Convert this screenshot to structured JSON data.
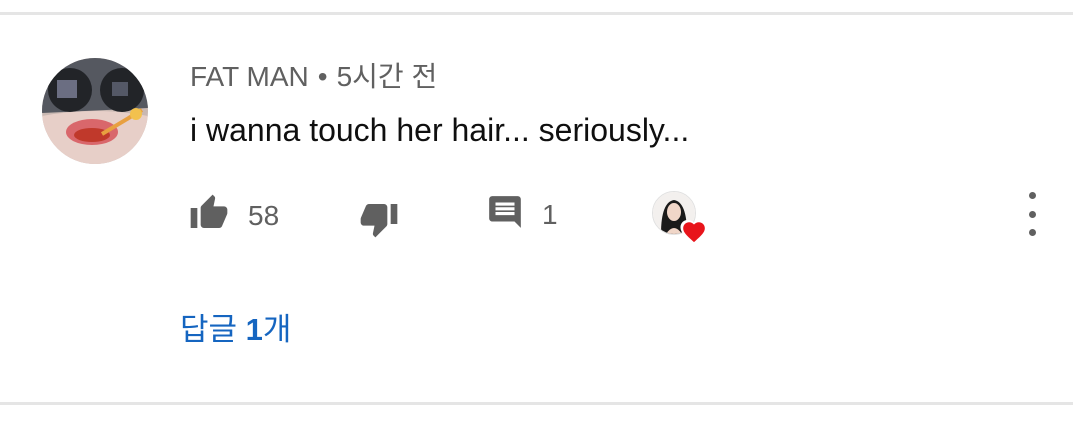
{
  "comment": {
    "author": "FAT MAN",
    "separator": "•",
    "time_ago": "5시간 전",
    "text": "i wanna touch her hair... seriously...",
    "like_count": "58",
    "reply_count": "1",
    "replies_link": {
      "prefix": "답글 ",
      "count": "1",
      "suffix": "개"
    },
    "icons": {
      "like": "thumb-up-icon",
      "dislike": "thumb-down-icon",
      "reply": "comment-icon",
      "creator_heart": "heart-icon",
      "menu": "more-vertical-icon"
    },
    "colors": {
      "link": "#1565c0",
      "meta": "#606060",
      "heart": "#e8141b"
    }
  }
}
